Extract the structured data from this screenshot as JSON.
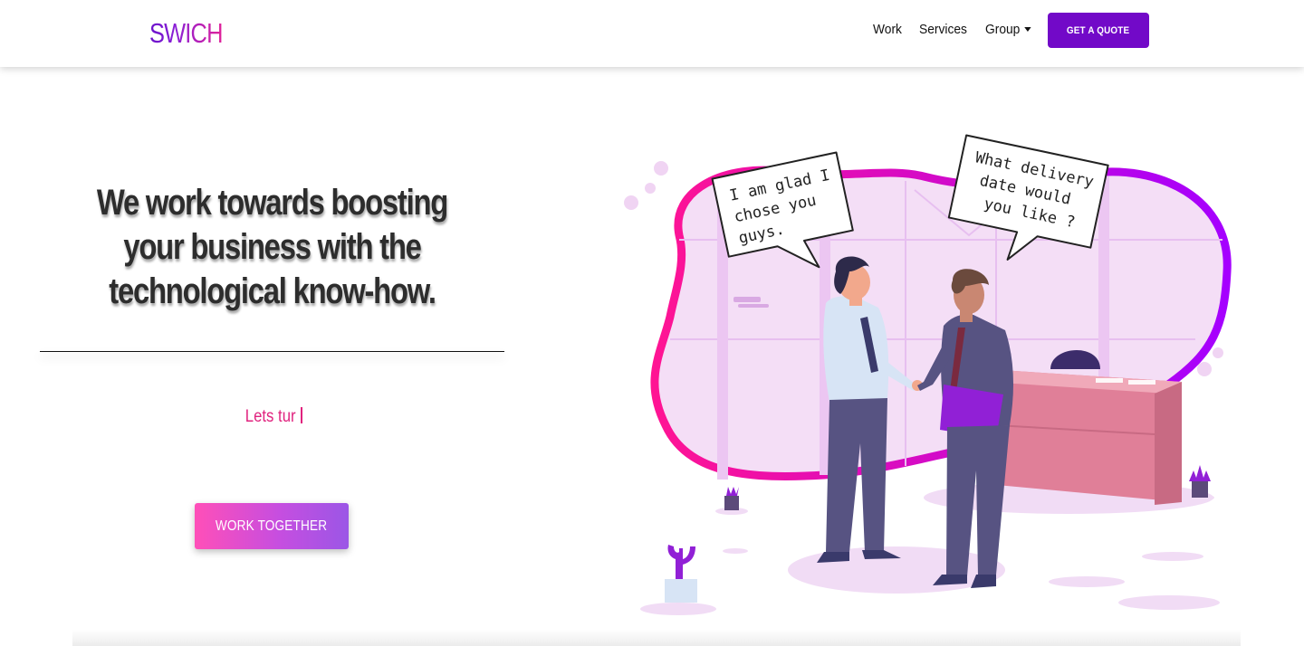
{
  "navbar": {
    "brand": "SWICH",
    "links": [
      {
        "label": "Work"
      },
      {
        "label": "Services"
      },
      {
        "label": "Group"
      }
    ],
    "cta_label": "GET A QUOTE"
  },
  "hero": {
    "headline_lines": [
      "We work towards boosting",
      "your business with the",
      "technological know-how."
    ],
    "typed_text": "Lets tur",
    "button_label": "WORK TOGETHER"
  },
  "illustration": {
    "bubble_left": [
      "I am glad I",
      "chose you",
      "guys."
    ],
    "bubble_right": [
      "What delivery",
      "date would",
      "you like ?"
    ]
  },
  "colors": {
    "accent": "#7209c8",
    "pink": "#e0227e",
    "blob_stroke_start": "#ff1493",
    "blob_stroke_end": "#a500ff"
  }
}
